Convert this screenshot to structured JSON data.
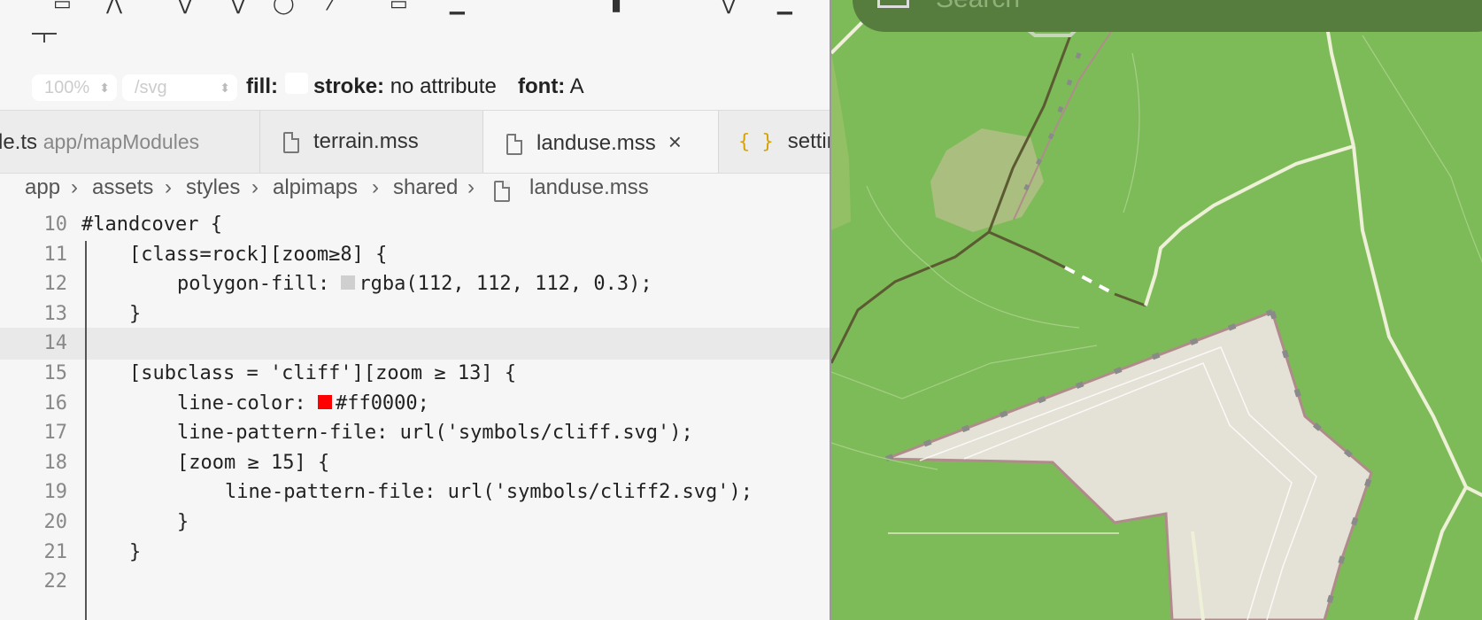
{
  "toolbar": {
    "icons": [
      "toolbar-icons"
    ]
  },
  "svg_bar": {
    "zoom_value": "100%",
    "path_value": "/svg",
    "fill_label": "fill:",
    "stroke_label": "stroke:",
    "stroke_value": "no attribute",
    "font_label": "font:",
    "font_value": "A"
  },
  "tabs": [
    {
      "label": "le.ts",
      "path": "app/mapModules"
    },
    {
      "label": "terrain.mss"
    },
    {
      "label": "landuse.mss",
      "active": true
    },
    {
      "label": "settin"
    }
  ],
  "breadcrumb": [
    "app",
    "assets",
    "styles",
    "alpimaps",
    "shared",
    "landuse.mss"
  ],
  "code": {
    "lines": [
      {
        "n": "10",
        "text": "#landcover {"
      },
      {
        "n": "11",
        "text": "[class=rock][zoom≥8] {"
      },
      {
        "n": "12",
        "prop": "polygon-fill:",
        "swatch": "#cfcfcf",
        "value": "rgba(112, 112, 112, 0.3);"
      },
      {
        "n": "13",
        "text": "}"
      },
      {
        "n": "14",
        "text": ""
      },
      {
        "n": "15",
        "text": "[subclass = 'cliff'][zoom ≥ 13] {"
      },
      {
        "n": "16",
        "prop": "line-color:",
        "swatch": "#ff0000",
        "value": "#ff0000;"
      },
      {
        "n": "17",
        "text": "line-pattern-file: url('symbols/cliff.svg');"
      },
      {
        "n": "18",
        "text": "[zoom ≥ 15] {"
      },
      {
        "n": "19",
        "text": "line-pattern-file: url('symbols/cliff2.svg');"
      },
      {
        "n": "20",
        "text": "}"
      },
      {
        "n": "21",
        "text": "}"
      },
      {
        "n": "22",
        "text": ""
      }
    ]
  },
  "map": {
    "search_placeholder": "Search",
    "colors": {
      "grass": "#7dbb58",
      "rock": "#e4e1d6",
      "cliff_edge": "#b08b8b",
      "path": "#5b5a32",
      "trail": "#eef0d8"
    }
  }
}
